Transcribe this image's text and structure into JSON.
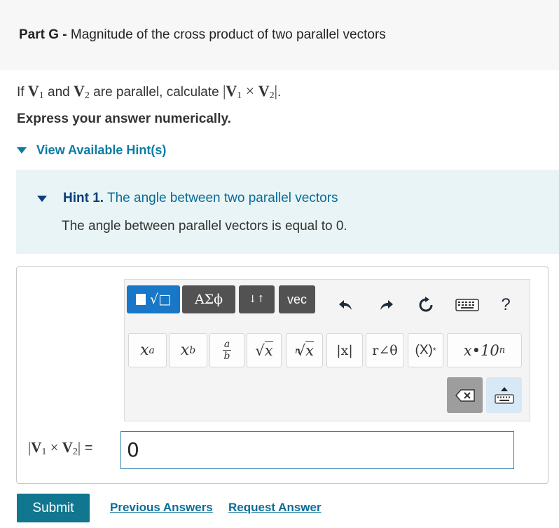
{
  "header": {
    "part_label": "Part G -",
    "title": "Magnitude of the cross product of two parallel vectors"
  },
  "question": {
    "prefix": "If",
    "v1": "V",
    "v1_sub": "1",
    "and": "and",
    "v2": "V",
    "v2_sub": "2",
    "middle": "are parallel, calculate",
    "expr_open": "|",
    "expr_cross": "×",
    "expr_close": "|",
    "period": "."
  },
  "instruction": "Express your answer numerically.",
  "hints": {
    "toggle_label": "View Available Hint(s)",
    "hint1_label": "Hint 1.",
    "hint1_title": "The angle between two parallel vectors",
    "hint1_body": "The angle between parallel vectors is equal to 0."
  },
  "toolbar": {
    "tabs": [
      {
        "name": "templates",
        "label": "√□"
      },
      {
        "name": "greek",
        "label": "ΑΣϕ"
      },
      {
        "name": "arrows",
        "label": "↓↑"
      },
      {
        "name": "vec",
        "label": "vec"
      }
    ],
    "help_label": "?",
    "keys": {
      "power_base": "x",
      "power_exp": "a",
      "sub_base": "x",
      "sub_idx": "b",
      "frac_num": "a",
      "frac_den": "b",
      "sqrt_arg": "x",
      "nroot_index": "n",
      "nroot_arg": "x",
      "abs": "|x|",
      "polar": "r∠θ",
      "conj": "(X)",
      "conj_mark": "*",
      "sci": "x•10",
      "sci_exp": "n"
    }
  },
  "answer": {
    "label_open": "|",
    "label_v1": "V",
    "label_v1_sub": "1",
    "label_cross": "×",
    "label_v2": "V",
    "label_v2_sub": "2",
    "label_close": "|",
    "label_equals": "=",
    "value": "0"
  },
  "actions": {
    "submit_label": "Submit",
    "previous_label": "Previous Answers",
    "request_label": "Request Answer"
  },
  "colors": {
    "accent": "#11768f",
    "link": "#0a6d99",
    "tab_active": "#1877c6",
    "tab_inactive": "#525252",
    "hint_bg": "#e8f4f5"
  }
}
